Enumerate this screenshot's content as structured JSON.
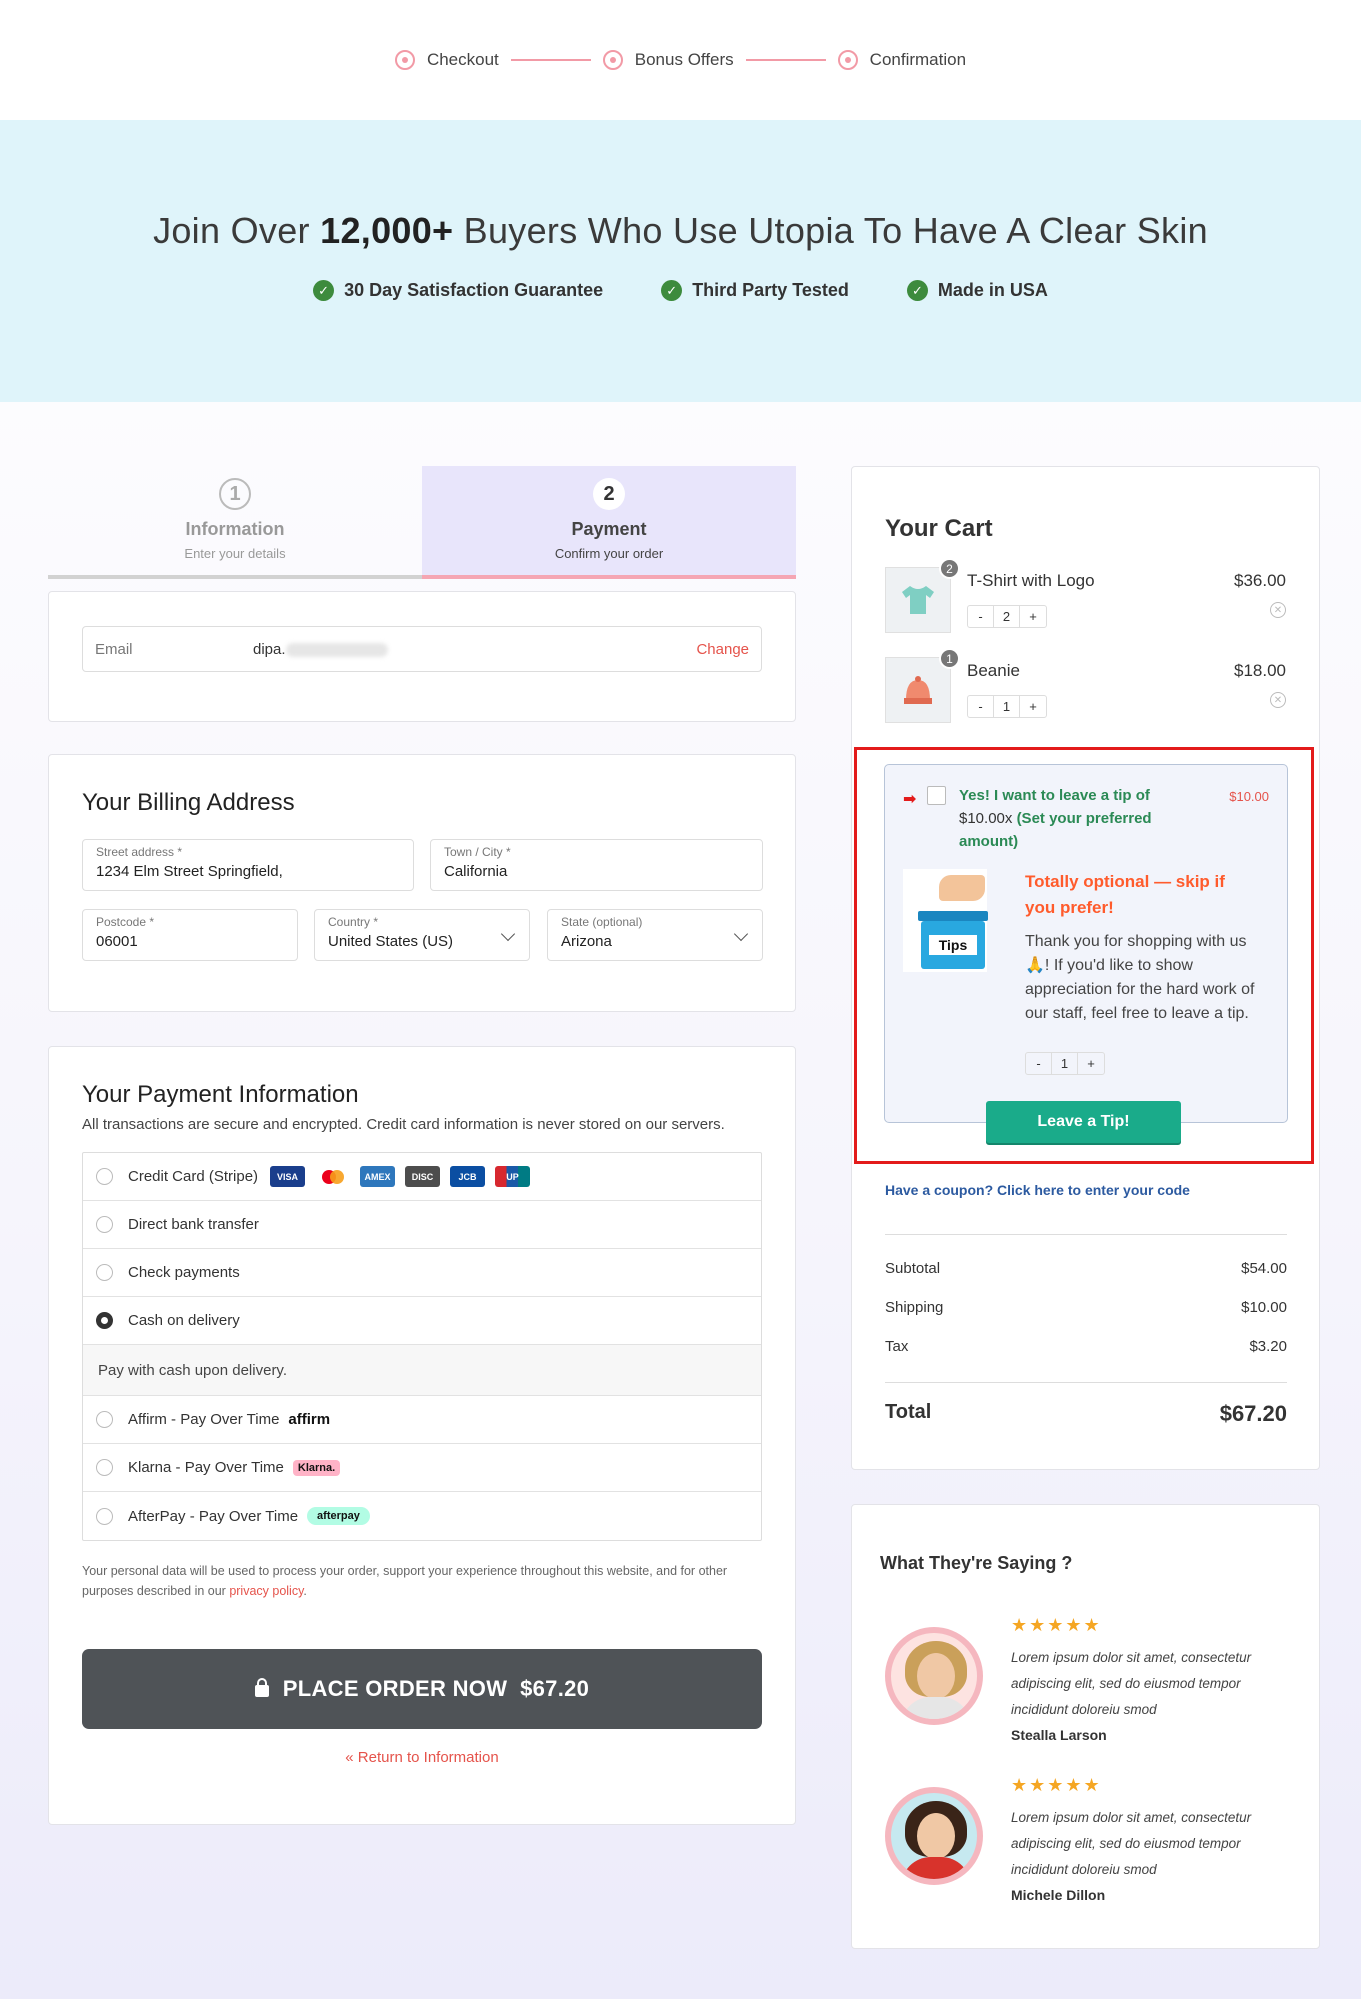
{
  "progress": {
    "steps": [
      "Checkout",
      "Bonus Offers",
      "Confirmation"
    ]
  },
  "hero": {
    "title_pre": "Join Over ",
    "title_bold": "12,000+",
    "title_post": " Buyers Who Use Utopia To Have A Clear Skin",
    "badges": [
      "30 Day Satisfaction Guarantee",
      "Third Party Tested",
      "Made in USA"
    ]
  },
  "tabs": [
    {
      "num": "1",
      "title": "Information",
      "subtitle": "Enter your details"
    },
    {
      "num": "2",
      "title": "Payment",
      "subtitle": "Confirm your order"
    }
  ],
  "email": {
    "label": "Email",
    "value": "dipa.",
    "change": "Change"
  },
  "billing": {
    "heading": "Your Billing Address",
    "street_label": "Street address *",
    "street": "1234 Elm Street Springfield,",
    "city_label": "Town / City *",
    "city": "California",
    "postcode_label": "Postcode *",
    "postcode": "06001",
    "country_label": "Country *",
    "country": "United States (US)",
    "state_label": "State (optional)",
    "state": "Arizona"
  },
  "payment": {
    "heading": "Your Payment Information",
    "description": "All transactions are secure and encrypted. Credit card information is never stored on our servers.",
    "methods": [
      "Credit Card (Stripe)",
      "Direct bank transfer",
      "Check payments",
      "Cash on delivery",
      "Affirm - Pay Over Time",
      "Klarna - Pay Over Time",
      "AfterPay - Pay Over Time"
    ],
    "selected": "Cash on delivery",
    "cod_note": "Pay with cash upon delivery.",
    "card_logos": [
      "VISA",
      "MC",
      "AMEX",
      "DISC",
      "JCB",
      "UP"
    ],
    "affirm_logo": "affirm",
    "klarna_logo": "Klarna.",
    "afterpay_logo": "afterpay",
    "privacy_text": "Your personal data will be used to process your order, support your experience throughout this website, and for other purposes described in our ",
    "privacy_link": "privacy policy",
    "privacy_end": ".",
    "place_order": "PLACE ORDER NOW",
    "place_order_total": "$67.20",
    "return_link": "« Return to Information"
  },
  "cart": {
    "heading": "Your Cart",
    "items": [
      {
        "name": "T-Shirt with Logo",
        "price": "$36.00",
        "qty": "2"
      },
      {
        "name": "Beanie",
        "price": "$18.00",
        "qty": "1"
      }
    ],
    "tip": {
      "label_bold": "Yes! I want to leave a tip of",
      "label_plain": "$10.00x",
      "label_tail": "(Set your preferred amount)",
      "amount": "$10.00",
      "image_text": "Tips",
      "title": "Totally optional — skip if you prefer!",
      "body": "Thank you for shopping with us🙏! If you'd like to show appreciation for the hard work of our staff, feel free to leave a tip.",
      "qty": "1",
      "button": "Leave a Tip!"
    },
    "coupon": "Have a coupon? Click here to enter your code",
    "subtotal_label": "Subtotal",
    "subtotal": "$54.00",
    "shipping_label": "Shipping",
    "shipping": "$10.00",
    "tax_label": "Tax",
    "tax": "$3.20",
    "total_label": "Total",
    "total": "$67.20"
  },
  "testimonials": {
    "heading": "What They're Saying ?",
    "stars": "★★★★★",
    "reviews": [
      {
        "text": "Lorem ipsum dolor sit amet, consectetur adipiscing elit, sed do eiusmod tempor incididunt doloreiu smod",
        "name": "Stealla Larson"
      },
      {
        "text": "Lorem ipsum dolor sit amet, consectetur adipiscing elit, sed do eiusmod tempor incididunt doloreiu smod",
        "name": "Michele Dillon"
      }
    ]
  },
  "colors": {
    "accent_pink": "#f29aa6",
    "hero_bg": "#dff4fa",
    "tip_green": "#1aab8a",
    "highlight_red": "#e31b1b"
  }
}
